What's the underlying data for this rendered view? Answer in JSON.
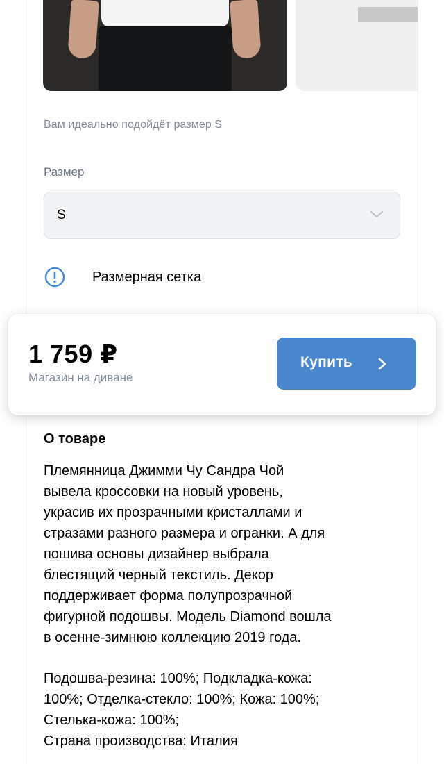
{
  "size_hint": "Вам идеально подойдёт размер S",
  "size_field": {
    "label": "Размер",
    "selected": "S"
  },
  "size_chart_link": "Размерная сетка",
  "purchase": {
    "price": "1 759 ₽",
    "seller": "Магазин на диване",
    "buy_label": "Купить"
  },
  "about": {
    "title": "О товаре",
    "description_lines": [
      "Племянница Джимми Чу Сандра Чой",
      "вывела кроссовки на новый уровень,",
      "украсив их прозрачными кристаллами и",
      "стразами разного размера и огранки. А для",
      "пошива основы дизайнер выбрала",
      "блестящий черный текстиль. Декор",
      "поддерживает форма полупрозрачной",
      "фигурной подошвы. Модель Diamond вошла",
      "в осенне-зимнюю коллекцию 2019 года."
    ],
    "spec_lines": [
      "Подошва-резина: 100%; Подкладка-кожа:",
      "100%; Отделка-стекло: 100%; Кожа: 100%;",
      "Стелька-кожа: 100%;",
      "Страна производства: Италия"
    ]
  },
  "colors": {
    "accent": "#4986cc",
    "secondary_text": "#818c99",
    "field_bg": "#f2f3f5"
  }
}
